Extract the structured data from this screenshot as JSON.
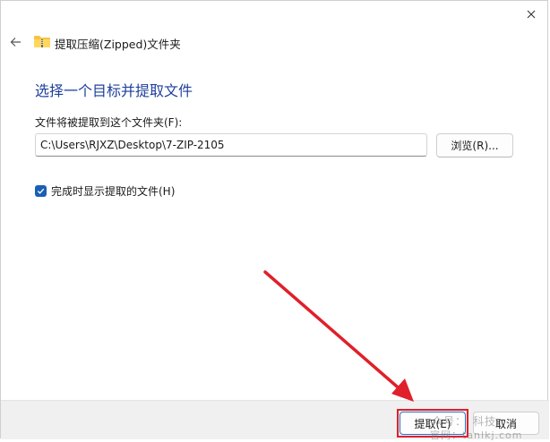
{
  "window": {
    "title": "提取压缩(Zipped)文件夹",
    "close_symbol": "✕"
  },
  "main": {
    "heading": "选择一个目标并提取文件",
    "dest_label": "文件将被提取到这个文件夹(F):",
    "path_value": "C:\\Users\\RJXZ\\Desktop\\7-ZIP-2105",
    "browse_label": "浏览(R)...",
    "show_files_label": "完成时显示提取的文件(H)",
    "show_files_checked": true
  },
  "footer": {
    "extract_label": "提取(E)",
    "cancel_label": "取消"
  },
  "watermark": {
    "line1": "众号：　科技",
    "line2": "官网：tanlkj.com"
  },
  "icons": {
    "back": "back-arrow-icon",
    "folder": "zip-folder-icon",
    "close": "close-icon",
    "check": "checkmark-icon"
  },
  "colors": {
    "heading": "#1f3f9b",
    "checkbox": "#1a5fb4",
    "annotation_red": "#e0202a",
    "primary_border": "#2a6fd0"
  }
}
